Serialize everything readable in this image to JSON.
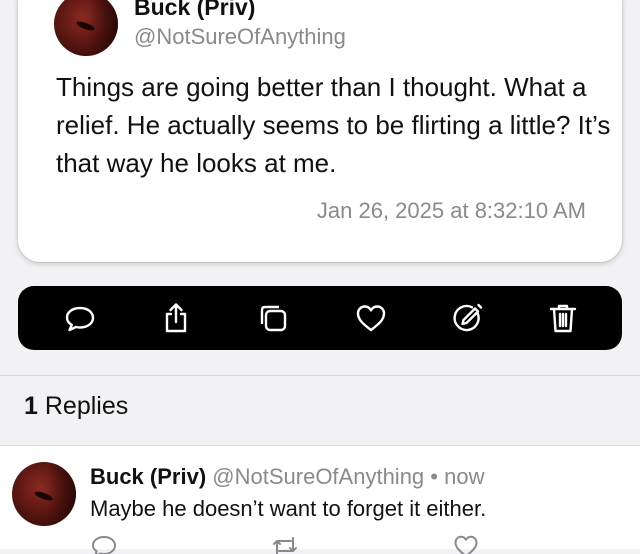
{
  "post": {
    "author_name": "Buck (Priv)",
    "author_handle": "@NotSureOfAnything",
    "body": "Things are going better than I thought. What a relief. He actually seems to be flirting a little? It’s that way he looks at me.",
    "timestamp": "Jan 26, 2025 at 8:32:10 AM"
  },
  "actions": [
    {
      "name": "reply",
      "icon": "speech-bubble-icon"
    },
    {
      "name": "share",
      "icon": "share-icon"
    },
    {
      "name": "copy",
      "icon": "copy-icon"
    },
    {
      "name": "like",
      "icon": "heart-icon"
    },
    {
      "name": "edit",
      "icon": "edit-icon"
    },
    {
      "name": "delete",
      "icon": "trash-icon"
    }
  ],
  "replies": {
    "count": "1",
    "label": "Replies"
  },
  "reply": {
    "author_name": "Buck (Priv)",
    "author_handle": "@NotSureOfAnything",
    "separator": "•",
    "time": "now",
    "text": "Maybe he doesn’t want to forget it either."
  },
  "colors": {
    "background": "#f2f2f4",
    "card": "#ffffff",
    "action_bar": "#000000",
    "secondary_text": "#8a8a8e"
  }
}
